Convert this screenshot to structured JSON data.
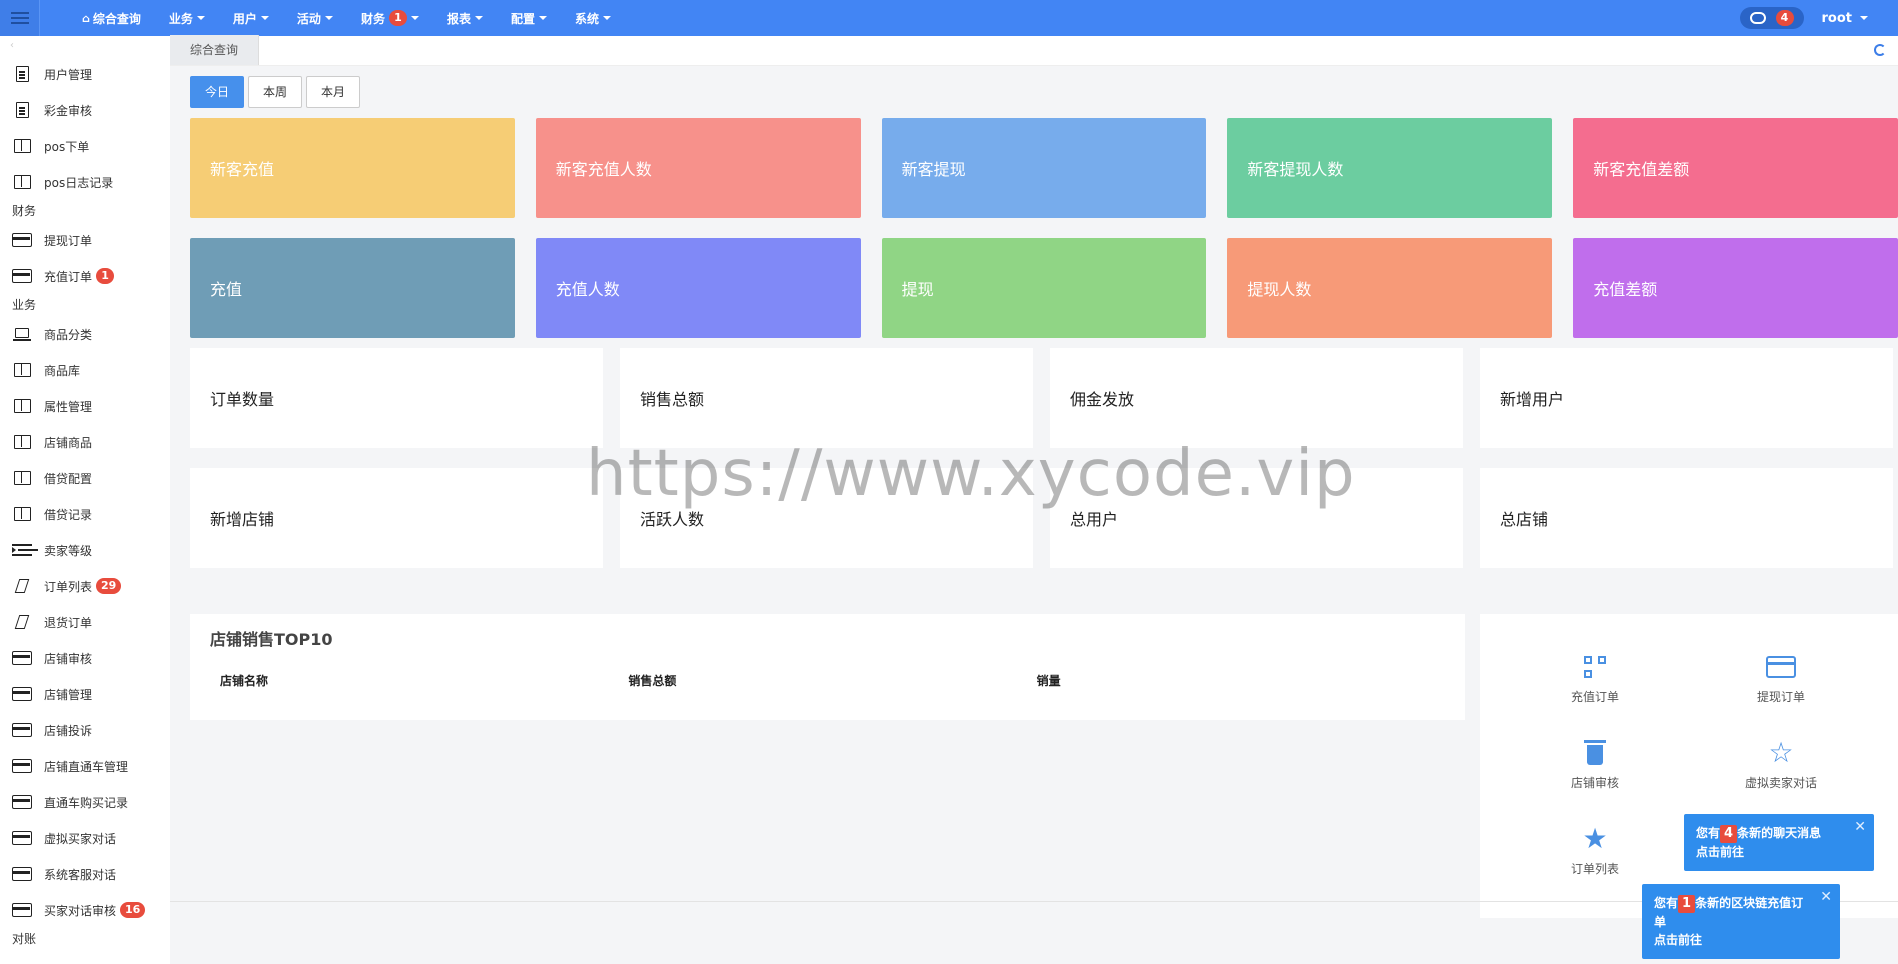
{
  "topbar": {
    "nav": [
      {
        "label": "综合查询",
        "home": true,
        "caret": false
      },
      {
        "label": "业务",
        "caret": true
      },
      {
        "label": "用户",
        "caret": true
      },
      {
        "label": "活动",
        "caret": true
      },
      {
        "label": "财务",
        "caret": true,
        "badge": "1"
      },
      {
        "label": "报表",
        "caret": true
      },
      {
        "label": "配置",
        "caret": true
      },
      {
        "label": "系统",
        "caret": true
      }
    ],
    "chat_badge": "4",
    "user": "root",
    "color": "#4285f4"
  },
  "sidebar": {
    "items": [
      {
        "type": "item",
        "icon": "doc-icon",
        "label": "用户管理"
      },
      {
        "type": "item",
        "icon": "doc-icon",
        "label": "彩金审核"
      },
      {
        "type": "item",
        "icon": "columns-icon",
        "label": "pos下单"
      },
      {
        "type": "item",
        "icon": "columns-icon",
        "label": "pos日志记录"
      },
      {
        "type": "group",
        "label": "财务"
      },
      {
        "type": "item",
        "icon": "card-icon",
        "label": "提现订单"
      },
      {
        "type": "item",
        "icon": "card-icon",
        "label": "充值订单",
        "badge": "1"
      },
      {
        "type": "group",
        "label": "业务"
      },
      {
        "type": "item",
        "icon": "laptop-icon",
        "label": "商品分类"
      },
      {
        "type": "item",
        "icon": "columns-icon",
        "label": "商品库"
      },
      {
        "type": "item",
        "icon": "columns-icon",
        "label": "属性管理"
      },
      {
        "type": "item",
        "icon": "columns-icon",
        "label": "店铺商品"
      },
      {
        "type": "item",
        "icon": "columns-icon",
        "label": "借贷配置"
      },
      {
        "type": "item",
        "icon": "columns-icon",
        "label": "借贷记录"
      },
      {
        "type": "item",
        "icon": "indent-icon",
        "label": "卖家等级"
      },
      {
        "type": "item",
        "icon": "slash-icon",
        "label": "订单列表",
        "badge": "29"
      },
      {
        "type": "item",
        "icon": "slash-icon",
        "label": "退货订单"
      },
      {
        "type": "item",
        "icon": "card-icon",
        "label": "店铺审核"
      },
      {
        "type": "item",
        "icon": "card-icon",
        "label": "店铺管理"
      },
      {
        "type": "item",
        "icon": "card-icon",
        "label": "店铺投诉"
      },
      {
        "type": "item",
        "icon": "card-icon",
        "label": "店铺直通车管理"
      },
      {
        "type": "item",
        "icon": "card-icon",
        "label": "直通车购买记录"
      },
      {
        "type": "item",
        "icon": "card-icon",
        "label": "虚拟买家对话"
      },
      {
        "type": "item",
        "icon": "card-icon",
        "label": "系统客服对话"
      },
      {
        "type": "item",
        "icon": "card-icon",
        "label": "买家对话审核",
        "badge": "16"
      },
      {
        "type": "group",
        "label": "对账"
      }
    ]
  },
  "tabs": [
    {
      "label": "综合查询"
    }
  ],
  "periods": [
    {
      "label": "今日",
      "active": true
    },
    {
      "label": "本周",
      "active": false
    },
    {
      "label": "本月",
      "active": false
    }
  ],
  "stat_rows": [
    [
      {
        "label": "新客充值",
        "color": "#f6cd75"
      },
      {
        "label": "新客充值人数",
        "color": "#f7918b"
      },
      {
        "label": "新客提现",
        "color": "#77acec"
      },
      {
        "label": "新客提现人数",
        "color": "#6ccda0"
      },
      {
        "label": "新客充值差额",
        "color": "#f46d8f"
      }
    ],
    [
      {
        "label": "充值",
        "color": "#6f9db6"
      },
      {
        "label": "充值人数",
        "color": "#8089f7"
      },
      {
        "label": "提现",
        "color": "#90d585"
      },
      {
        "label": "提现人数",
        "color": "#f79a78"
      },
      {
        "label": "充值差额",
        "color": "#c06eec"
      }
    ]
  ],
  "white_rows": [
    [
      "订单数量",
      "销售总额",
      "佣金发放",
      "新增用户"
    ],
    [
      "新增店铺",
      "活跃人数",
      "总用户",
      "总店铺"
    ]
  ],
  "top10": {
    "title": "店铺销售TOP10",
    "columns": [
      "店铺名称",
      "销售总额",
      "销量"
    ]
  },
  "quick_links": [
    {
      "label": "充值订单",
      "icon": "qrcode-icon"
    },
    {
      "label": "提现订单",
      "icon": "credit-card-icon"
    },
    {
      "label": "店铺审核",
      "icon": "trash-icon"
    },
    {
      "label": "虚拟卖家对话",
      "icon": "star-outline-icon"
    },
    {
      "label": "订单列表",
      "icon": "star-icon"
    },
    {
      "label": "",
      "icon": "chevron-down-icon"
    }
  ],
  "watermark": "https://www.xycode.vip",
  "toasts": [
    {
      "prefix": "您有",
      "count": "4",
      "suffix": "条新的聊天消息",
      "link": "点击前往"
    },
    {
      "prefix": "您有",
      "count": "1",
      "suffix": "条新的区块链充值订单",
      "link": "点击前往"
    }
  ]
}
